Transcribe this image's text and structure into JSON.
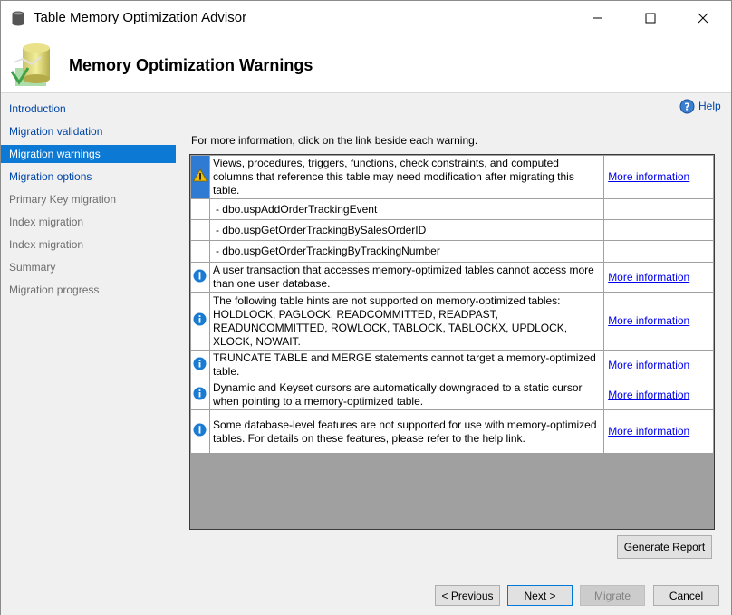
{
  "window": {
    "title": "Table Memory Optimization Advisor"
  },
  "header": {
    "title": "Memory Optimization Warnings"
  },
  "sidebar": {
    "items": [
      {
        "label": "Introduction",
        "state": "link"
      },
      {
        "label": "Migration validation",
        "state": "link"
      },
      {
        "label": "Migration warnings",
        "state": "selected"
      },
      {
        "label": "Migration options",
        "state": "link"
      },
      {
        "label": "Primary Key migration",
        "state": "disabled"
      },
      {
        "label": "Index migration",
        "state": "disabled"
      },
      {
        "label": "Index migration",
        "state": "disabled"
      },
      {
        "label": "Summary",
        "state": "disabled"
      },
      {
        "label": "Migration progress",
        "state": "disabled"
      }
    ]
  },
  "main": {
    "help_label": "Help",
    "intro_text": "For more information, click on the link beside each warning.",
    "warnings": [
      {
        "icon": "warning-icon",
        "message": "Views, procedures, triggers, functions, check constraints, and computed columns that reference this table may need modification after migrating this table.",
        "link": "More information"
      },
      {
        "icon": "",
        "message": "- dbo.uspAddOrderTrackingEvent",
        "link": ""
      },
      {
        "icon": "",
        "message": "- dbo.uspGetOrderTrackingBySalesOrderID",
        "link": ""
      },
      {
        "icon": "",
        "message": "- dbo.uspGetOrderTrackingByTrackingNumber",
        "link": ""
      },
      {
        "icon": "info-icon",
        "message": "A user transaction that accesses memory-optimized tables cannot access more than one user database.",
        "link": "More information"
      },
      {
        "icon": "info-icon",
        "message": "The following table hints are not supported on memory-optimized tables: HOLDLOCK, PAGLOCK, READCOMMITTED, READPAST, READUNCOMMITTED, ROWLOCK, TABLOCK, TABLOCKX, UPDLOCK, XLOCK, NOWAIT.",
        "link": "More information"
      },
      {
        "icon": "info-icon",
        "message": "TRUNCATE TABLE and MERGE statements cannot target a memory-optimized table.",
        "link": "More information"
      },
      {
        "icon": "info-icon",
        "message": "Dynamic and Keyset cursors are automatically downgraded to a static cursor when pointing to a memory-optimized table.",
        "link": "More information"
      },
      {
        "icon": "info-icon",
        "message": "Some database-level features are not supported for use with memory-optimized tables. For details on these features, please refer to the help link.",
        "link": "More information"
      }
    ]
  },
  "buttons": {
    "generate_report": "Generate Report",
    "previous": "< Previous",
    "next": "Next >",
    "migrate": "Migrate",
    "cancel": "Cancel"
  },
  "colors": {
    "selected_nav_bg": "#0c79d4",
    "link_text": "#0046a8",
    "hyperlink": "#0000ee",
    "warning_icon_bg": "#2f7bd3",
    "info_icon": "#1a7bd2",
    "warning_icon": "#f0c000"
  }
}
